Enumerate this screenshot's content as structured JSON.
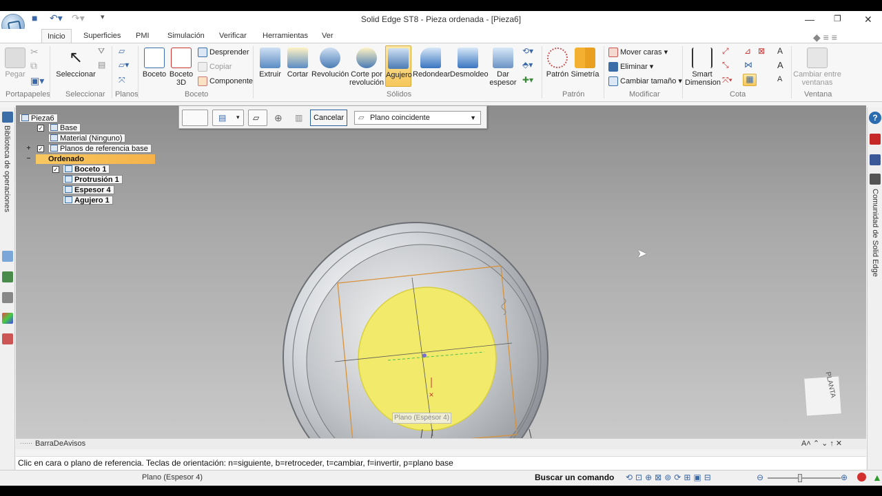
{
  "app": {
    "title": "Solid Edge ST8 - Pieza ordenada - [Pieza6]"
  },
  "tabs": [
    "Inicio",
    "Superficies",
    "PMI",
    "Simulación",
    "Verificar",
    "Herramientas",
    "Ver"
  ],
  "ribbon": {
    "groups": {
      "portapapeles": "Portapapeles",
      "seleccionar": "Seleccionar",
      "planos": "Planos",
      "boceto": "Boceto",
      "solidos": "Sólidos",
      "patron": "Patrón",
      "modificar": "Modificar",
      "cota": "Cota",
      "ventana": "Ventana"
    },
    "pegar": "Pegar",
    "seleccionar": "Seleccionar",
    "boceto": "Boceto",
    "boceto3d_1": "Boceto",
    "boceto3d_2": "3D",
    "desprender": "Desprender",
    "copiar": "Copiar",
    "componente": "Componente",
    "extruir": "Extruir",
    "cortar": "Cortar",
    "revolucion": "Revolución",
    "corte_rev_1": "Corte por",
    "corte_rev_2": "revolución",
    "agujero": "Agujero",
    "redondear": "Redondear",
    "desmoldeo": "Desmoldeo",
    "dar_espesor_1": "Dar",
    "dar_espesor_2": "espesor",
    "patron": "Patrón",
    "simetria": "Simetría",
    "mover_caras": "Mover caras",
    "eliminar": "Eliminar",
    "cambiar_tamano": "Cambiar tamaño",
    "smart_dim_1": "Smart",
    "smart_dim_2": "Dimension",
    "cambiar_ventanas_1": "Cambiar entre",
    "cambiar_ventanas_2": "ventanas"
  },
  "left_panel": {
    "label": "Biblioteca de operaciones"
  },
  "right_panel": {
    "label": "Comunidad de Solid Edge"
  },
  "tree": {
    "root": "Pieza6",
    "base": "Base",
    "material": "Material (Ninguno)",
    "planos": "Planos de referencia base",
    "ordenado": "Ordenado",
    "boceto1": "Boceto 1",
    "protrusion1": "Protrusión 1",
    "espesor4": "Espesor 4",
    "agujero1": "Agujero 1"
  },
  "command_bar": {
    "cancel": "Cancelar",
    "plane_option": "Plano coincidente"
  },
  "viewport": {
    "plane_tag": "Plano (Espesor 4)",
    "cube_label": "PLANTA"
  },
  "status": {
    "bar_title": "BarraDeAvisos",
    "prompt": "Clic en cara o plano de referencia. Teclas de orientación: n=siguiente, b=retroceder, t=cambiar, f=invertir, p=plano base",
    "selection": "Plano (Espesor 4)",
    "find_command": "Buscar un comando"
  },
  "colors": {
    "highlight": "#f5c65a",
    "accent": "#3b6ea8",
    "yellow_face": "#f1ea6a"
  }
}
